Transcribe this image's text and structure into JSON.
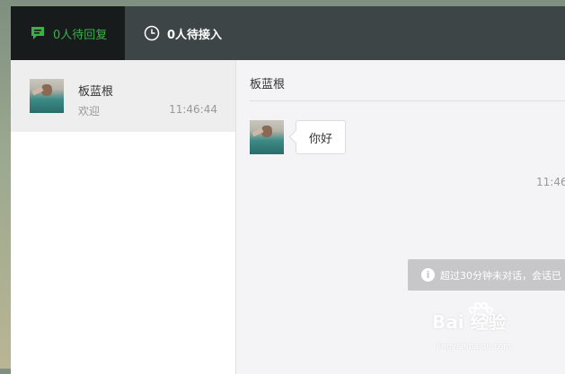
{
  "tabs": {
    "waiting_reply": {
      "label": "0人待回复",
      "icon": "chat-bubble-icon",
      "active": true,
      "accent": "#3bb149"
    },
    "waiting_accept": {
      "label": "0人待接入",
      "icon": "clock-icon"
    }
  },
  "sessions": [
    {
      "name": "板蓝根",
      "last_message": "欢迎",
      "time": "11:46:44"
    }
  ],
  "chat": {
    "title": "板蓝根",
    "messages": [
      {
        "text": "你好"
      }
    ],
    "message_time": "11:46",
    "notice": "超过30分钟未对话，会话已"
  },
  "watermark": {
    "text": "Bai 经验",
    "sub": "jingyan.baidu.com"
  }
}
